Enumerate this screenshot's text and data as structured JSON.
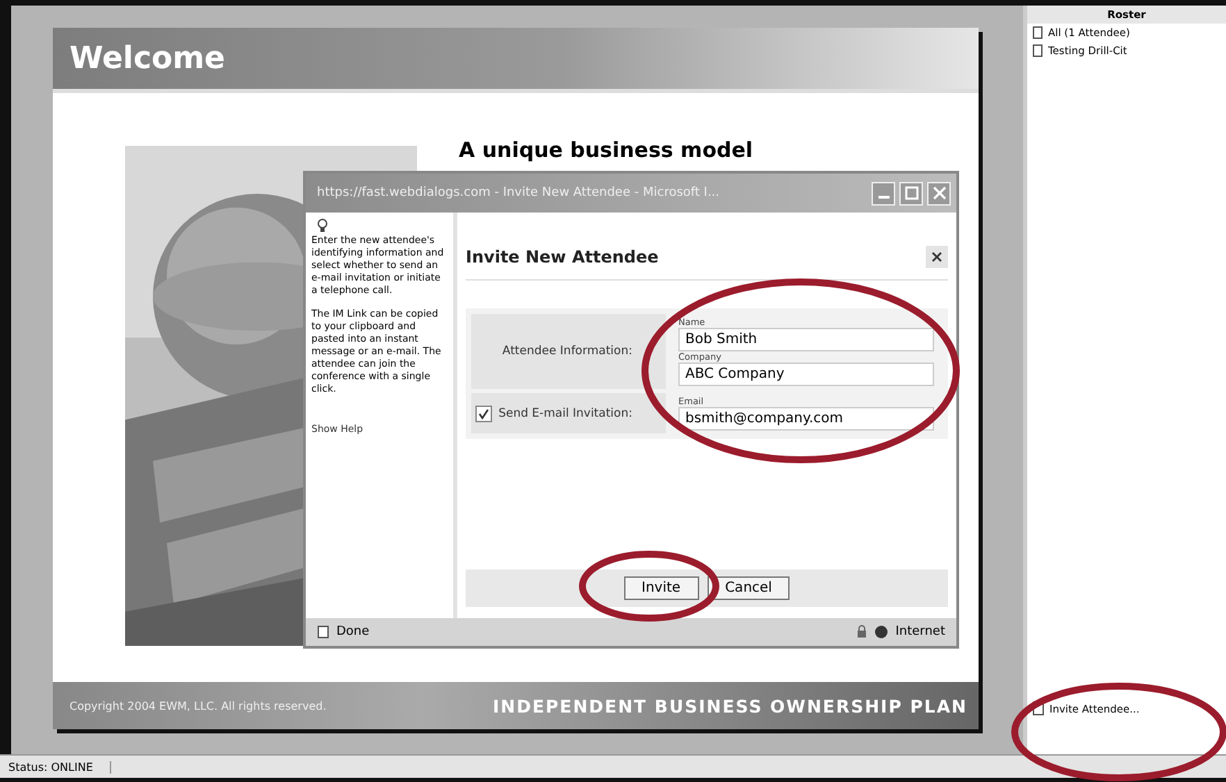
{
  "slide": {
    "title": "Welcome",
    "headline": "A unique business model",
    "copyright": "Copyright 2004 EWM, LLC. All rights reserved.",
    "plan": "INDEPENDENT BUSINESS OWNERSHIP PLAN"
  },
  "dialog": {
    "title": "https://fast.webdialogs.com - Invite New Attendee - Microsoft I...",
    "help_text": [
      "Enter the new attendee's identifying information and select whether to send an e-mail invitation or initiate a telephone call.",
      "The IM Link can be copied to your clipboard and pasted into an instant message or an e-mail. The attendee can join the conference with a single click."
    ],
    "help_link": "Show Help",
    "heading": "Invite New Attendee",
    "section_label": "Attendee Information:",
    "fields": [
      {
        "label": "Name",
        "value": "Bob Smith"
      },
      {
        "label": "Company",
        "value": "ABC Company"
      }
    ],
    "email_invite": {
      "label": "Send E-mail Invitation:",
      "checked": true
    },
    "email_field": {
      "label": "Email",
      "value": "bsmith@company.com"
    },
    "buttons": [
      "Invite",
      "Cancel"
    ],
    "status": "Done",
    "zone": "Internet"
  },
  "roster": {
    "title": "Roster",
    "items": [
      "All (1 Attendee)",
      "Testing Drill-Cit"
    ]
  },
  "invite_link": "Invite Attendee...",
  "status_bar": "Status: ONLINE"
}
